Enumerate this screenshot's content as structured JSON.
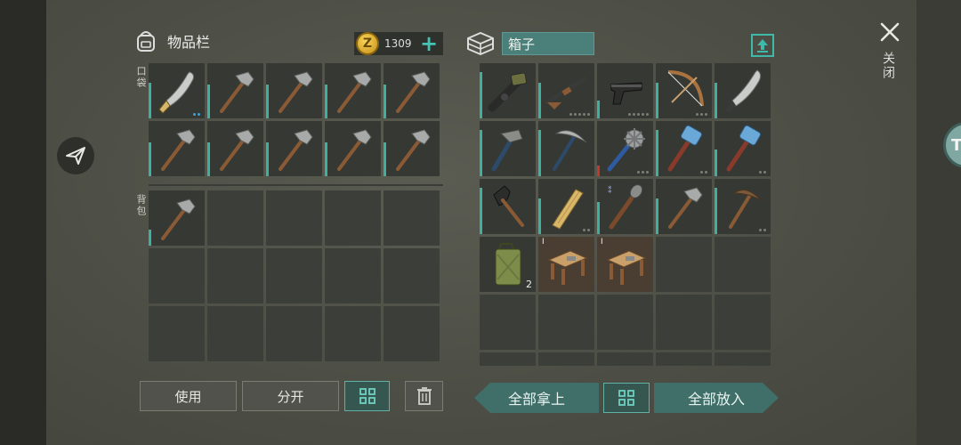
{
  "inventory": {
    "title": "物品栏",
    "coins": "1309",
    "coin_symbol": "Z",
    "pocket_label": "口袋",
    "backpack_label": "背包"
  },
  "box": {
    "title": "箱子"
  },
  "close_label": "关闭",
  "side_badge": "T",
  "buttons": {
    "use": "使用",
    "split": "分开",
    "take_all": "全部拿上",
    "put_all": "全部放入"
  },
  "box_items": {
    "jerrycan_qty": "2",
    "bench1_tier": "I",
    "bench2_tier": "I"
  },
  "colors": {
    "accent": "#3fb0a0",
    "panel": "#363834",
    "coin": "#e0a925"
  }
}
